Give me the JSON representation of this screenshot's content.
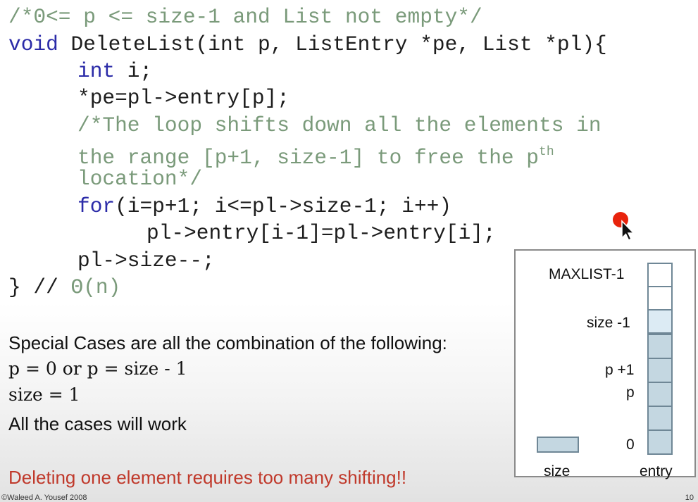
{
  "code": {
    "l1": "/*0<= p <= size-1 and List not empty*/",
    "l2_kw": "void",
    "l2_rest": " DeleteList(int p, ListEntry *pe, List *pl){",
    "l3_kw": "int",
    "l3_rest": " i;",
    "l4": "*pe=pl->entry[p];",
    "l5": "/*The loop shifts down all the elements in",
    "l6_text": "the range [p+1, size-1] to free the p",
    "l6_sup": "th",
    "l7": "location*/",
    "l8_kw": "for",
    "l8_rest": "(i=p+1; i<=pl->size-1; i++)",
    "l9": "pl->entry[i-1]=pl->entry[i];",
    "l10": "pl->size--;",
    "l11_brace": "} //",
    "l11_comment": "Θ(n)"
  },
  "prose": {
    "special_cases": "Special Cases are all the combination of the following:",
    "case1": "p = 0 or p = size - 1",
    "case2": "size = 1",
    "all_work": "All the cases will work",
    "warning": "Deleting one element requires too many shifting!!"
  },
  "diagram": {
    "labels": {
      "maxlist": "MAXLIST-1",
      "size_minus_1": "size -1",
      "p_plus_1": "p +1",
      "p": "p",
      "zero": "0",
      "size": "size",
      "entry": "entry"
    }
  },
  "footer": {
    "copyright": "©Waleed A. Yousef 2008",
    "page": "10"
  },
  "colors": {
    "keyword": "#2b2ba8",
    "comment": "#7a9a7a",
    "warning": "#c0392b",
    "cell_fill": "#c4d7e1",
    "cursor_dot": "#e8230c"
  },
  "icons": {
    "cursor": "mouse-pointer-icon"
  }
}
